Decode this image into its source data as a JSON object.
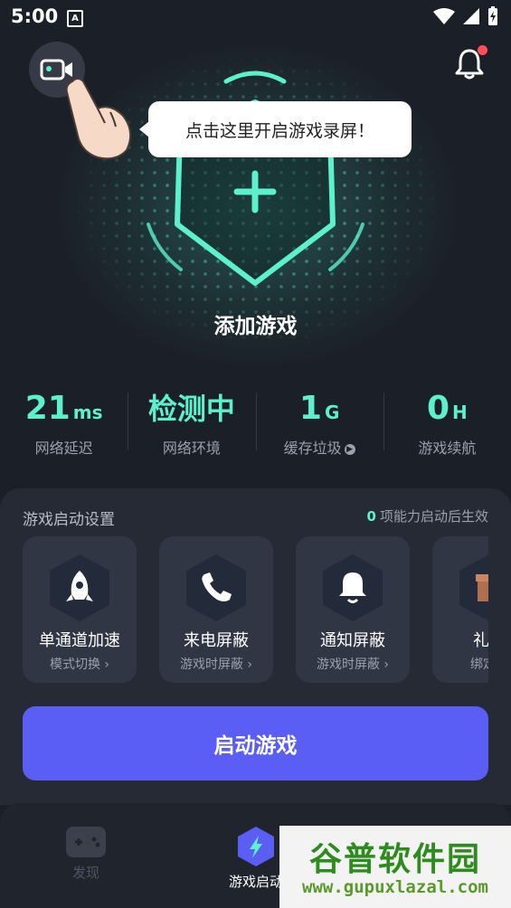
{
  "status_bar": {
    "time": "5:00",
    "app_icon": "A"
  },
  "hero": {
    "add_game_label": "添加游戏",
    "tooltip": "点击这里开启游戏录屏！"
  },
  "stats": [
    {
      "value": "21",
      "unit": "ms",
      "label": "网络延迟"
    },
    {
      "value": "检测中",
      "unit": "",
      "label": "网络环境"
    },
    {
      "value": "1",
      "unit": "G",
      "label": "缓存垃圾"
    },
    {
      "value": "0",
      "unit": "H",
      "label": "游戏续航"
    }
  ],
  "settings": {
    "title": "游戏启动设置",
    "note_count": "0",
    "note_text": "项能力启动后生效",
    "cards": [
      {
        "title": "单通道加速",
        "sub": "模式切换",
        "icon": "rocket-icon"
      },
      {
        "title": "来电屏蔽",
        "sub": "游戏时屏蔽",
        "icon": "phone-icon"
      },
      {
        "title": "通知屏蔽",
        "sub": "游戏时屏蔽",
        "icon": "bell-icon"
      },
      {
        "title": "礼包",
        "sub": "绑定区",
        "icon": "gift-icon"
      }
    ],
    "launch_label": "启动游戏"
  },
  "nav": [
    {
      "label": "发现",
      "icon": "gamepad-icon"
    },
    {
      "label": "游戏启动",
      "icon": "lightning-icon"
    }
  ],
  "watermark": {
    "title": "谷普软件园",
    "url": "www.gupuxlazal.com"
  },
  "colors": {
    "accent": "#5cf0cd",
    "primary": "#5b5ef4",
    "background": "#1b1f27",
    "notice_dot": "#ff4d5e"
  }
}
